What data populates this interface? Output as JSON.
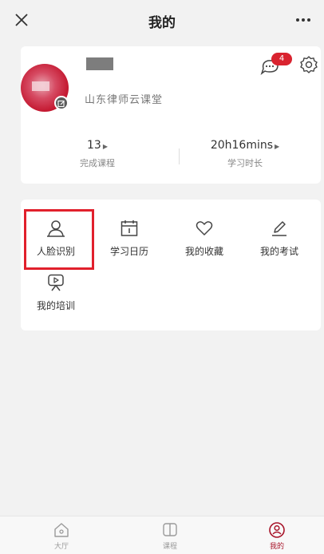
{
  "nav": {
    "title": "我的"
  },
  "profile": {
    "organization": "山东律师云课堂",
    "message_badge": "4"
  },
  "stats": [
    {
      "value": "13",
      "label": "完成课程"
    },
    {
      "value": "20h16mins",
      "label": "学习时长"
    }
  ],
  "menu": [
    {
      "label": "人脸识别",
      "icon": "face-recognition-icon"
    },
    {
      "label": "学习日历",
      "icon": "calendar-icon"
    },
    {
      "label": "我的收藏",
      "icon": "heart-icon"
    },
    {
      "label": "我的考试",
      "icon": "pencil-icon"
    },
    {
      "label": "我的培训",
      "icon": "training-icon"
    }
  ],
  "tabbar": [
    {
      "label": "大厅",
      "icon": "home-icon"
    },
    {
      "label": "课程",
      "icon": "book-icon"
    },
    {
      "label": "我的",
      "icon": "user-icon",
      "active": true
    }
  ],
  "colors": {
    "accent": "#a8152a",
    "highlight": "#e1202c",
    "badge": "#d9232f"
  }
}
